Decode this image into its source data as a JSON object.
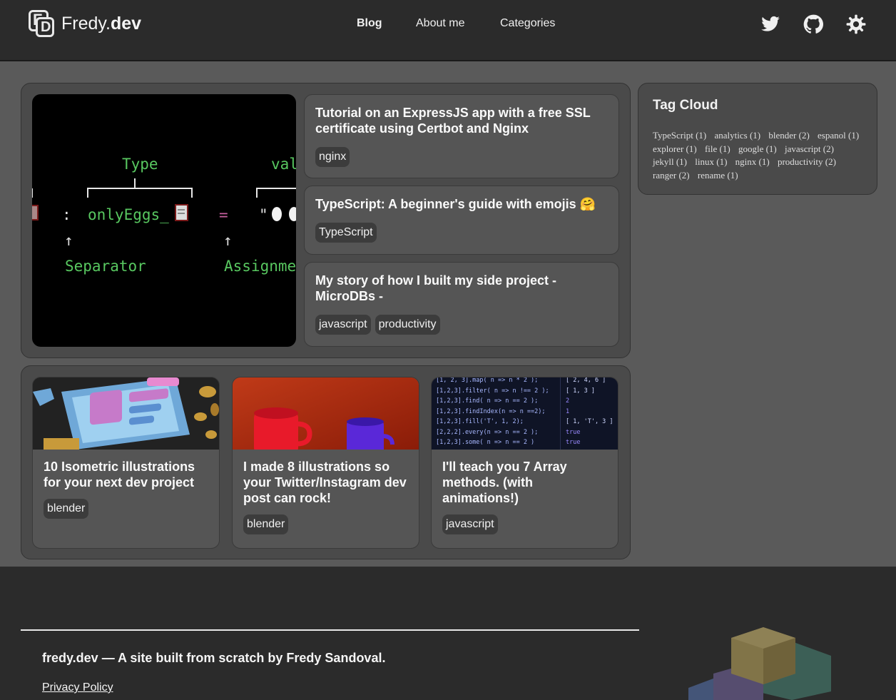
{
  "header": {
    "logo_letters": {
      "f": "F",
      "d": "D"
    },
    "site_name_prefix": "Fredy.",
    "site_name_suffix": "dev",
    "nav": [
      {
        "label": "Blog",
        "active": true
      },
      {
        "label": "About me",
        "active": false
      },
      {
        "label": "Categories",
        "active": false
      }
    ],
    "icons": [
      "twitter-icon",
      "github-icon",
      "theme-toggle-icon"
    ]
  },
  "hero": {
    "code": {
      "type_label": "Type",
      "val_label": "val",
      "colon": ":",
      "identifier": "onlyEggs_",
      "equals": "=",
      "quote": "\"",
      "arrow": "↑",
      "separator_label": "Separator",
      "assignment_label": "Assignme"
    }
  },
  "featured_posts": [
    {
      "title": "Tutorial on an ExpressJS app with a free SSL certificate using Certbot and Nginx",
      "tags": [
        "nginx"
      ]
    },
    {
      "title": "TypeScript: A beginner's guide with emojis 🤗",
      "tags": [
        "TypeScript"
      ]
    },
    {
      "title": "My story of how I built my side project - MicroDBs -",
      "tags": [
        "javascript",
        "productivity"
      ]
    }
  ],
  "grid_posts": [
    {
      "title": "10 Isometric illustrations for your next dev project",
      "tags": [
        "blender"
      ]
    },
    {
      "title": "I made 8 illustrations so your Twitter/Instagram dev post can rock!",
      "tags": [
        "blender"
      ]
    },
    {
      "title": "I'll teach you 7 Array methods. (with animations!)",
      "tags": [
        "javascript"
      ]
    }
  ],
  "array_code": {
    "left": [
      "[1, 2, 3].map( n => n * 2 );",
      "[1,2,3].filter( n => n !== 2 );",
      "[1,2,3].find( n => n == 2 );",
      "[1,2,3].findIndex(n => n ==2);",
      "[1,2,3].fill('T', 1, 2);",
      "[2,2,2].every(n => n == 2 );",
      "[1,2,3].some( n => n == 2 )"
    ],
    "right": [
      "[ 2, 4, 6 ]",
      "[ 1, 3 ]",
      "2",
      "1",
      "[ 1, 'T', 3 ]",
      "true",
      "true"
    ]
  },
  "tag_cloud": {
    "title": "Tag Cloud",
    "tags": [
      {
        "label": "TypeScript (1)"
      },
      {
        "label": "analytics (1)"
      },
      {
        "label": "blender (2)"
      },
      {
        "label": "espanol (1)"
      },
      {
        "label": "explorer (1)"
      },
      {
        "label": "file (1)"
      },
      {
        "label": "google (1)"
      },
      {
        "label": "javascript (2)"
      },
      {
        "label": "jekyll (1)"
      },
      {
        "label": "linux (1)"
      },
      {
        "label": "nginx (1)"
      },
      {
        "label": "productivity (2)"
      },
      {
        "label": "ranger (2)"
      },
      {
        "label": "rename (1)"
      }
    ]
  },
  "footer": {
    "text": "fredy.dev — A site built from scratch by Fredy Sandoval.",
    "privacy_link": "Privacy Policy"
  },
  "colors": {
    "page_bg": "#5a5a5a",
    "header_bg": "#2b2b2b",
    "panel_bg": "#4a4a4a",
    "card_bg": "#555555",
    "tag_bg": "#3c3c3c",
    "code_green": "#58c760"
  }
}
